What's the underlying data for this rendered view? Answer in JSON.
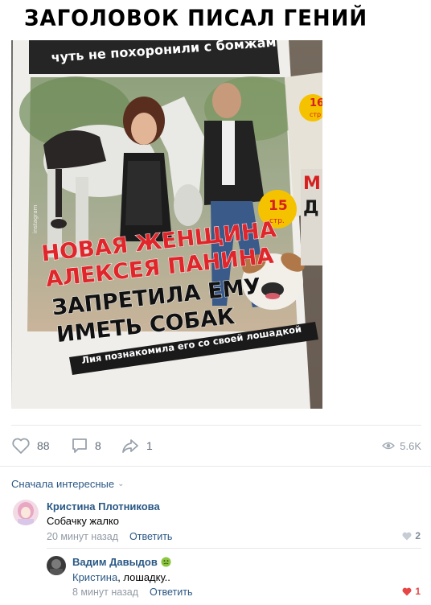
{
  "post": {
    "title": "ЗАГОЛОВОК ПИСАЛ ГЕНИЙ",
    "photo": {
      "top_line": "чуть не похоронили с бомжам",
      "headline_red_1": "НОВАЯ ЖЕНЩИНА",
      "headline_red_2": "АЛЕКСЕЯ ПАНИНА",
      "headline_black_1": "ЗАПРЕТИЛА ЕМУ",
      "headline_black_2": "ИМЕТЬ СОБАК",
      "caption": "Лия познакомила его со своей лошадкой",
      "badge_number": "15",
      "badge_label": "стр.",
      "side_badge_number": "16",
      "side_badge_label": "стр",
      "side_letter_1": "М",
      "side_letter_2": "Д",
      "watermark": "instagram"
    }
  },
  "actions": {
    "likes": "88",
    "comments": "8",
    "shares": "1",
    "views": "5.6K"
  },
  "comments_sort": {
    "label": "Сначала интересные"
  },
  "comments": [
    {
      "author": "Кристина Плотникова",
      "text": "Собачку жалко",
      "time": "20 минут назад",
      "reply_label": "Ответить",
      "likes": "2"
    }
  ],
  "reply": {
    "author": "Вадим Давыдов",
    "mention": "Кристина",
    "text": ", лошадку..",
    "time": "8 минут назад",
    "reply_label": "Ответить",
    "likes": "1"
  },
  "colors": {
    "link": "#2a5885",
    "muted": "#939ba5",
    "like_red": "#e64646",
    "headline_red": "#e0262b"
  }
}
